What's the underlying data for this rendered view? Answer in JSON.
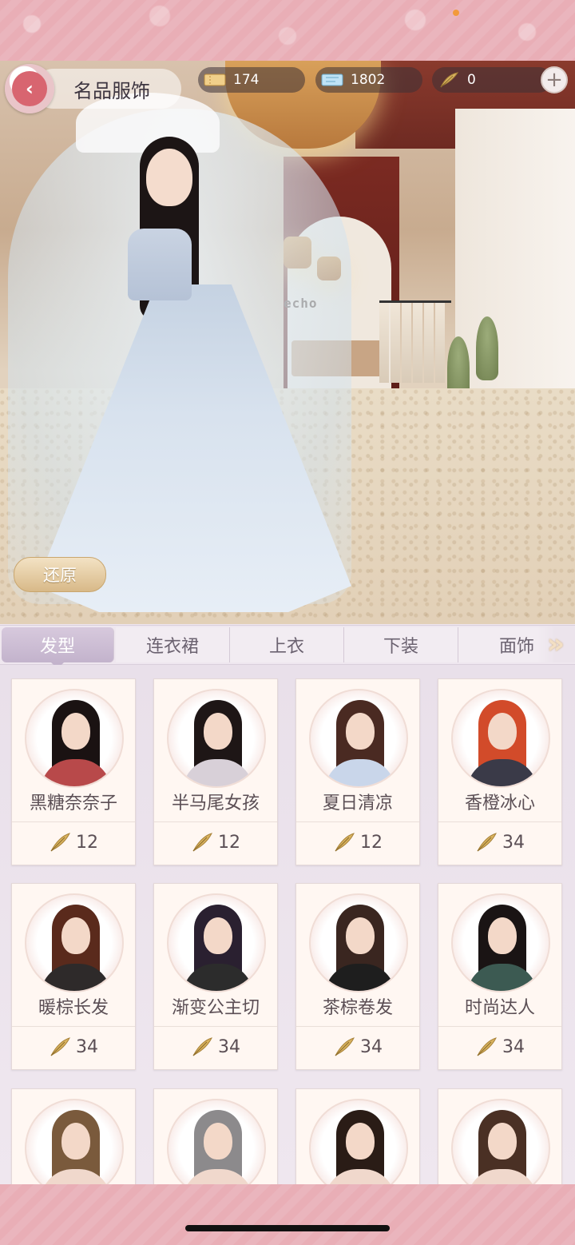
{
  "header": {
    "title": "名品服饰",
    "currencies": [
      {
        "icon": "ticket-icon",
        "value": "174"
      },
      {
        "icon": "diamond-card-icon",
        "value": "1802"
      },
      {
        "icon": "feather-icon",
        "value": "0"
      }
    ],
    "plus": "+"
  },
  "scene": {
    "shop_sign": "echo",
    "restore_label": "还原"
  },
  "tabs": [
    {
      "label": "发型",
      "active": true
    },
    {
      "label": "连衣裙",
      "active": false
    },
    {
      "label": "上衣",
      "active": false
    },
    {
      "label": "下装",
      "active": false
    },
    {
      "label": "面饰",
      "active": false
    }
  ],
  "tab_next": "»",
  "items": [
    {
      "name": "黑糖奈奈子",
      "price": "12"
    },
    {
      "name": "半马尾女孩",
      "price": "12"
    },
    {
      "name": "夏日清凉",
      "price": "12"
    },
    {
      "name": "香橙冰心",
      "price": "34"
    },
    {
      "name": "暖棕长发",
      "price": "34"
    },
    {
      "name": "渐变公主切",
      "price": "34"
    },
    {
      "name": "茶棕卷发",
      "price": "34"
    },
    {
      "name": "时尚达人",
      "price": "34"
    },
    {
      "name": "",
      "price": ""
    },
    {
      "name": "",
      "price": ""
    },
    {
      "name": "",
      "price": ""
    },
    {
      "name": "",
      "price": ""
    }
  ],
  "colors": {
    "accent_pink": "#e9aeb6",
    "back_button": "#d86570",
    "active_tab": "#c3b3cc",
    "feather_gold": "#c9a25a"
  }
}
